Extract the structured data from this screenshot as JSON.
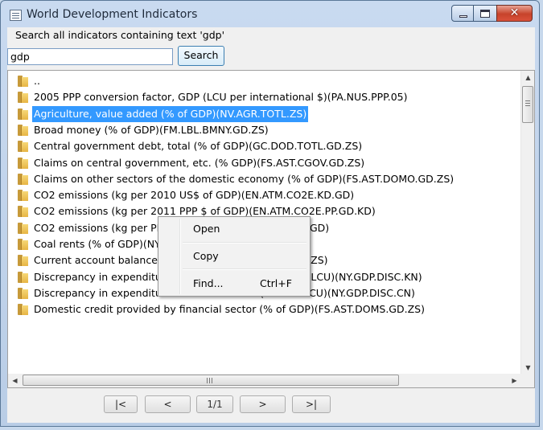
{
  "window": {
    "title": "World Development Indicators",
    "buttons": {
      "minimize": "minimize-icon",
      "maximize": "maximize-icon",
      "close": "✕"
    }
  },
  "search": {
    "label": "Search all indicators containing text 'gdp'",
    "value": "gdp",
    "button": "Search"
  },
  "list": {
    "items": [
      {
        "label": "..",
        "selected": false
      },
      {
        "label": "2005 PPP conversion factor, GDP (LCU per international $)(PA.NUS.PPP.05)",
        "selected": false
      },
      {
        "label": "Agriculture, value added (% of GDP)(NV.AGR.TOTL.ZS)",
        "selected": true
      },
      {
        "label": "Broad money (% of GDP)(FM.LBL.BMNY.GD.ZS)",
        "selected": false
      },
      {
        "label": "Central government debt, total (% of GDP)(GC.DOD.TOTL.GD.ZS)",
        "selected": false
      },
      {
        "label": "Claims on central government, etc. (% GDP)(FS.AST.CGOV.GD.ZS)",
        "selected": false
      },
      {
        "label": "Claims on other sectors of the domestic economy (% of GDP)(FS.AST.DOMO.GD.ZS)",
        "selected": false
      },
      {
        "label": "CO2 emissions (kg per 2010 US$ of GDP)(EN.ATM.CO2E.KD.GD)",
        "selected": false
      },
      {
        "label": "CO2 emissions (kg per 2011 PPP $ of GDP)(EN.ATM.CO2E.PP.GD.KD)",
        "selected": false
      },
      {
        "label": "CO2 emissions (kg per PPP $ of GDP)(EN.ATM.CO2E.PP.GD)",
        "selected": false
      },
      {
        "label": "Coal rents (% of GDP)(NY.GDP.COAL.RT.ZS)",
        "selected": false
      },
      {
        "label": "Current account balance (% of GDP)(BN.CAB.XOKA.GD.ZS)",
        "selected": false
      },
      {
        "label": "Discrepancy in expenditure estimate of GDP (constant LCU)(NY.GDP.DISC.KN)",
        "selected": false
      },
      {
        "label": "Discrepancy in expenditure estimate of GDP (current LCU)(NY.GDP.DISC.CN)",
        "selected": false
      },
      {
        "label": "Domestic credit provided by financial sector (% of GDP)(FS.AST.DOMS.GD.ZS)",
        "selected": false
      }
    ]
  },
  "context_menu": {
    "open": "Open",
    "copy": "Copy",
    "find": "Find...",
    "find_shortcut": "Ctrl+F"
  },
  "pager": {
    "first": "|<",
    "prev": "<",
    "page": "1/1",
    "next": ">",
    "last": ">|"
  },
  "scrollbars": {
    "up": "▲",
    "down": "▼",
    "left": "◀",
    "right": "▶"
  }
}
